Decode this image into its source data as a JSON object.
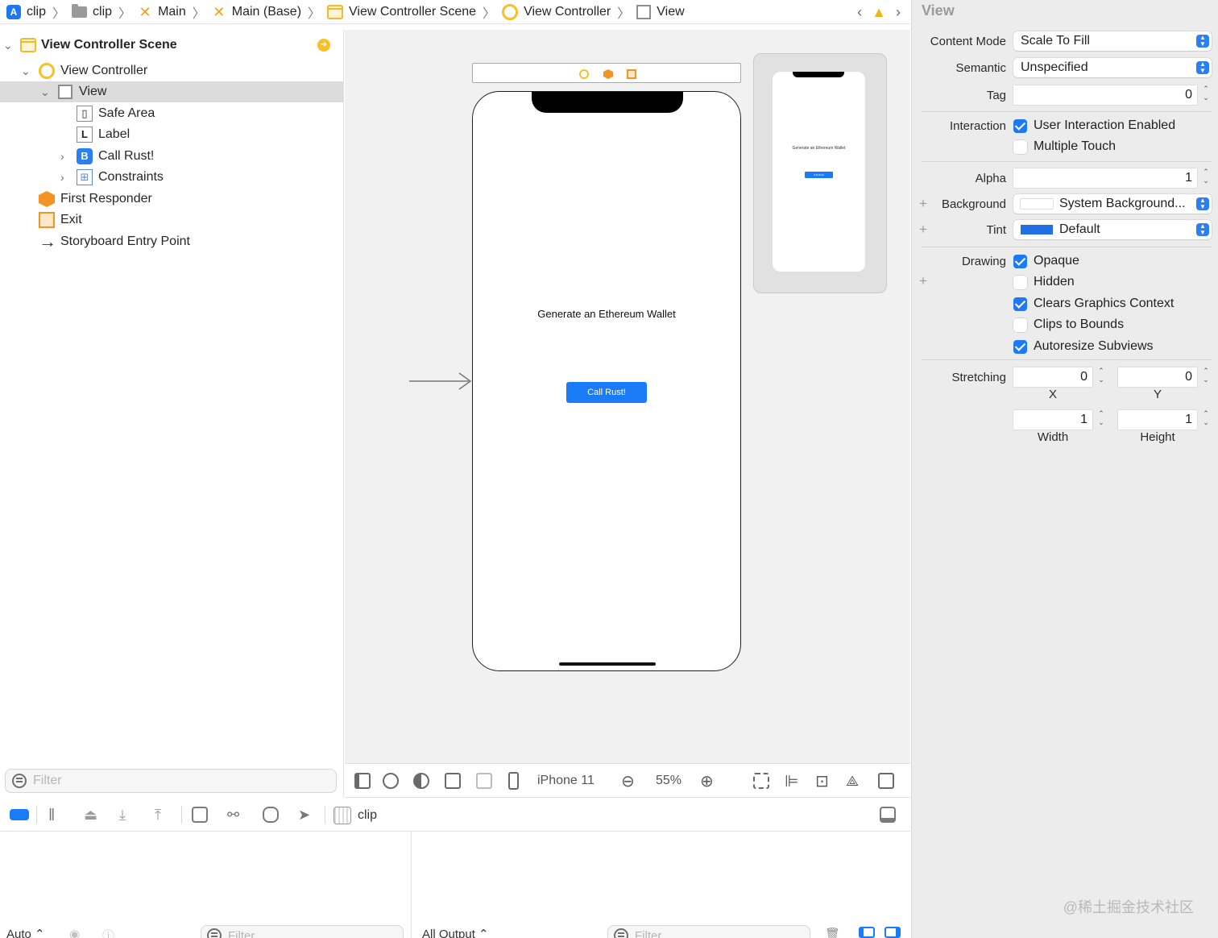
{
  "breadcrumb": [
    {
      "label": "clip",
      "icon": "app-icon"
    },
    {
      "label": "clip",
      "icon": "folder-icon"
    },
    {
      "label": "Main",
      "icon": "storyboard-icon"
    },
    {
      "label": "Main (Base)",
      "icon": "storyboard-icon"
    },
    {
      "label": "View Controller Scene",
      "icon": "scene-icon"
    },
    {
      "label": "View Controller",
      "icon": "view-controller-icon"
    },
    {
      "label": "View",
      "icon": "view-icon"
    }
  ],
  "navigator": {
    "scene_title": "View Controller Scene",
    "items": [
      {
        "label": "View Controller"
      },
      {
        "label": "View"
      },
      {
        "label": "Safe Area"
      },
      {
        "label": "Label",
        "glyph": "L"
      },
      {
        "label": "Call Rust!",
        "glyph": "B"
      },
      {
        "label": "Constraints"
      },
      {
        "label": "First Responder"
      },
      {
        "label": "Exit"
      },
      {
        "label": "Storyboard Entry Point"
      }
    ],
    "filter_placeholder": "Filter"
  },
  "canvas": {
    "label_text": "Generate an Ethereum Wallet",
    "button_text": "Call Rust!",
    "mini_label_text": "Generate an Ethereum Wallet",
    "mini_button_text": "Call Rust!"
  },
  "canvas_bar": {
    "device": "iPhone 11",
    "zoom": "55%"
  },
  "debug_bar": {
    "target": "clip"
  },
  "console": {
    "auto_label": "Auto ⌃",
    "output_label": "All Output ⌃",
    "filter_placeholder": "Filter"
  },
  "inspector": {
    "title": "View",
    "content_mode_label": "Content Mode",
    "content_mode_value": "Scale To Fill",
    "semantic_label": "Semantic",
    "semantic_value": "Unspecified",
    "tag_label": "Tag",
    "tag_value": "0",
    "interaction_label": "Interaction",
    "user_interaction": {
      "label": "User Interaction Enabled",
      "checked": true
    },
    "multiple_touch": {
      "label": "Multiple Touch",
      "checked": false
    },
    "alpha_label": "Alpha",
    "alpha_value": "1",
    "background_label": "Background",
    "background_value": "System Background...",
    "tint_label": "Tint",
    "tint_value": "Default",
    "tint_color": "#1f6fe5",
    "drawing_label": "Drawing",
    "opaque": {
      "label": "Opaque",
      "checked": true
    },
    "hidden": {
      "label": "Hidden",
      "checked": false
    },
    "clears_graphics": {
      "label": "Clears Graphics Context",
      "checked": true
    },
    "clips_to_bounds": {
      "label": "Clips to Bounds",
      "checked": false
    },
    "autoresize": {
      "label": "Autoresize Subviews",
      "checked": true
    },
    "stretching_label": "Stretching",
    "stretch_x": "0",
    "stretch_y": "0",
    "stretch_width": "1",
    "stretch_height": "1",
    "x_label": "X",
    "y_label": "Y",
    "width_label": "Width",
    "height_label": "Height"
  },
  "watermark": "@稀土掘金技术社区",
  "colors": {
    "accent": "#1a7bf6",
    "selection": "#dcdcdc",
    "canvas_bg": "#f1f1f1",
    "inspector_bg": "#ececec"
  }
}
